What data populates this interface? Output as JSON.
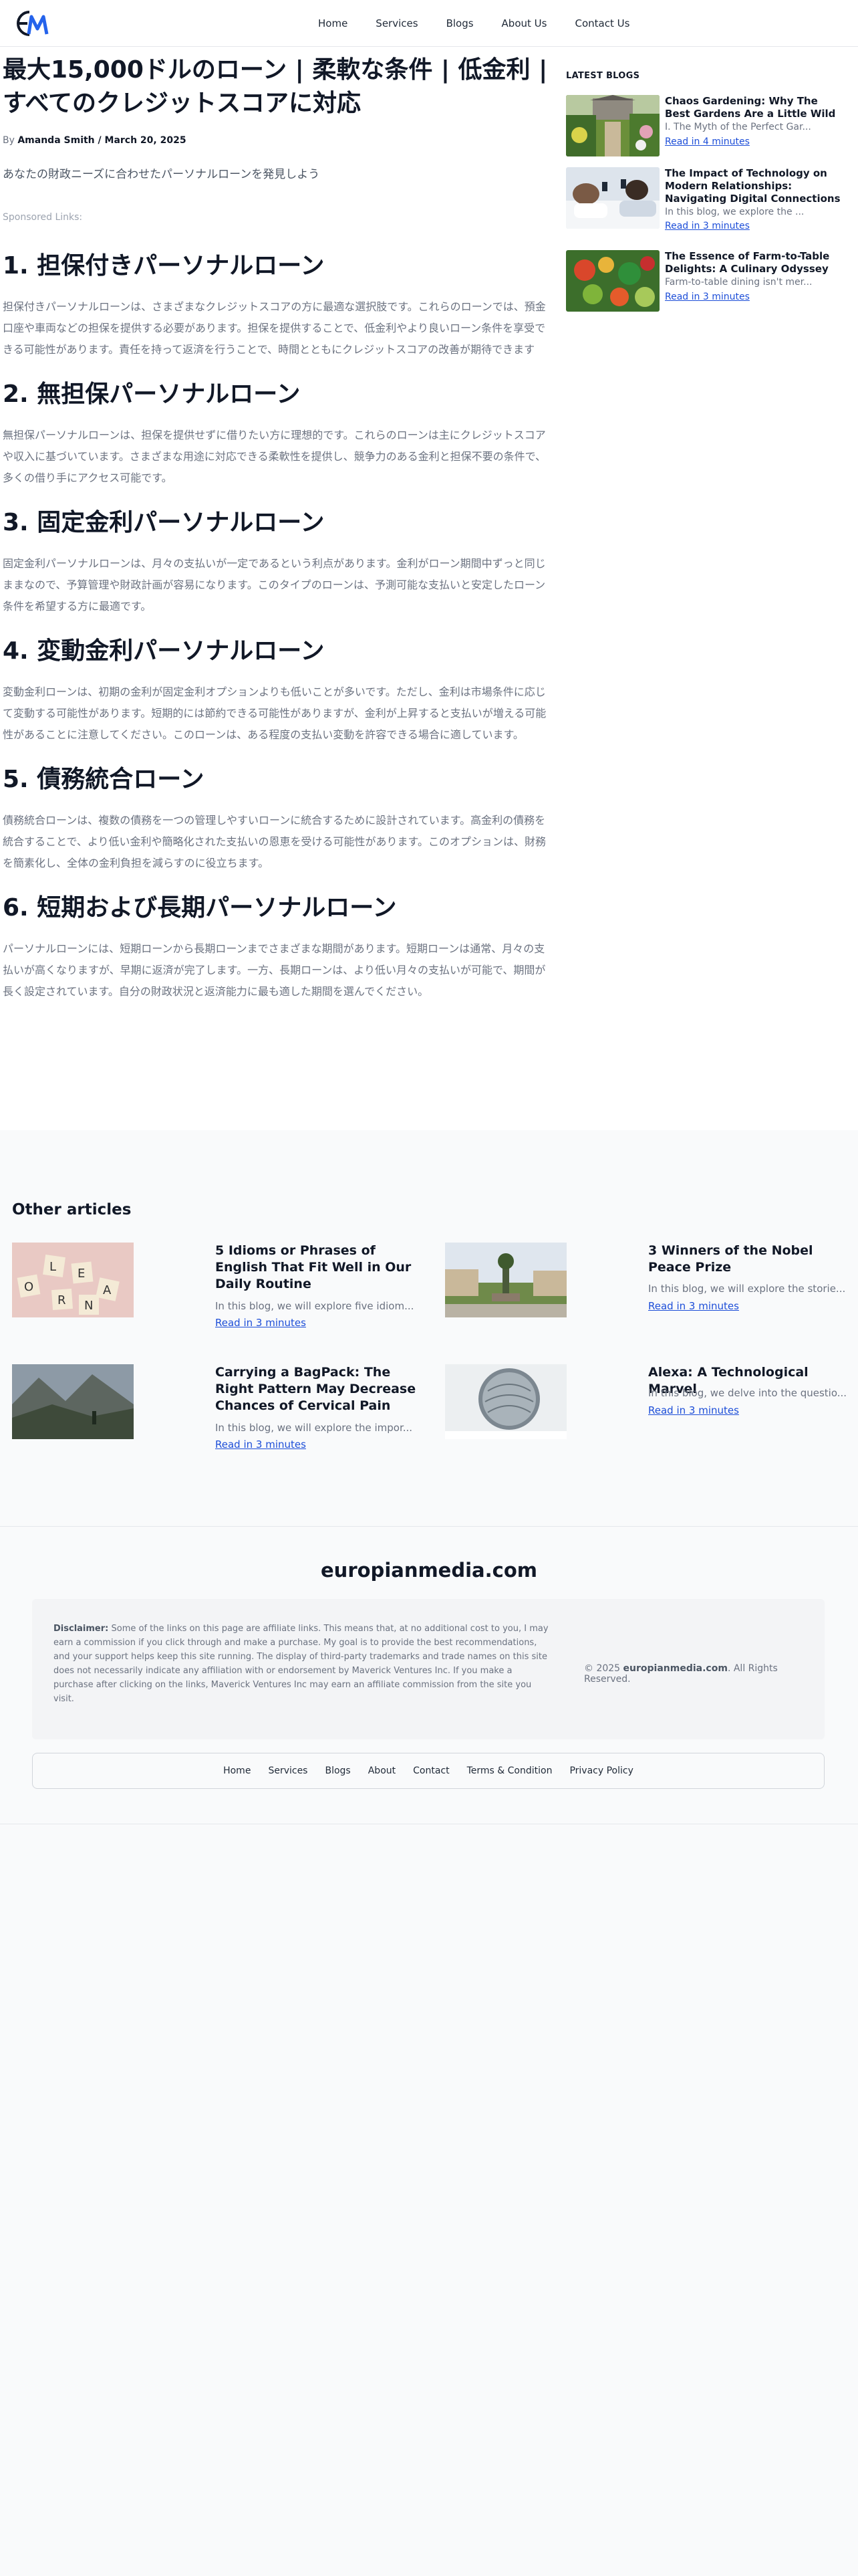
{
  "header": {
    "logo_text": "EM",
    "nav": [
      "Home",
      "Services",
      "Blogs",
      "About Us",
      "Contact Us"
    ]
  },
  "article": {
    "title": "最大15,000ドルのローン | 柔軟な条件 | 低金利 | すべてのクレジットスコアに対応",
    "by_prefix": "By",
    "author": "Amanda Smith / March 20, 2025",
    "intro": "あなたの財政ニーズに合わせたパーソナルローンを発見しよう",
    "sponsored": "Sponsored Links:",
    "sections": [
      {
        "heading": "1. 担保付きパーソナルローン",
        "body": "担保付きパーソナルローンは、さまざまなクレジットスコアの方に最適な選択肢です。これらのローンでは、預金口座や車両などの担保を提供する必要があります。担保を提供することで、低金利やより良いローン条件を享受できる可能性があります。責任を持って返済を行うことで、時間とともにクレジットスコアの改善が期待できます"
      },
      {
        "heading": "2. 無担保パーソナルローン",
        "body": "無担保パーソナルローンは、担保を提供せずに借りたい方に理想的です。これらのローンは主にクレジットスコアや収入に基づいています。さまざまな用途に対応できる柔軟性を提供し、競争力のある金利と担保不要の条件で、多くの借り手にアクセス可能です。"
      },
      {
        "heading": "3. 固定金利パーソナルローン",
        "body": "固定金利パーソナルローンは、月々の支払いが一定であるという利点があります。金利がローン期間中ずっと同じままなので、予算管理や財政計画が容易になります。このタイプのローンは、予測可能な支払いと安定したローン条件を希望する方に最適です。"
      },
      {
        "heading": "4. 変動金利パーソナルローン",
        "body": "変動金利ローンは、初期の金利が固定金利オプションよりも低いことが多いです。ただし、金利は市場条件に応じて変動する可能性があります。短期的には節約できる可能性がありますが、金利が上昇すると支払いが増える可能性があることに注意してください。このローンは、ある程度の支払い変動を許容できる場合に適しています。"
      },
      {
        "heading": "5. 債務統合ローン",
        "body": "債務統合ローンは、複数の債務を一つの管理しやすいローンに統合するために設計されています。高金利の債務を統合することで、より低い金利や簡略化された支払いの恩恵を受ける可能性があります。このオプションは、財務を簡素化し、全体の金利負担を減らすのに役立ちます。"
      },
      {
        "heading": "6. 短期および長期パーソナルローン",
        "body": "パーソナルローンには、短期ローンから長期ローンまでさまざまな期間があります。短期ローンは通常、月々の支払いが高くなりますが、早期に返済が完了します。一方、長期ローンは、より低い月々の支払いが可能で、期間が長く設定されています。自分の財政状況と返済能力に最も適した期間を選んでください。"
      }
    ]
  },
  "sidebar": {
    "title": "LATEST BLOGS",
    "items": [
      {
        "title": "Chaos Gardening: Why The Best Gardens Are a Little Wild",
        "desc": "I. The Myth of the Perfect Gar...",
        "link": "Read in 4 minutes"
      },
      {
        "title": "The Impact of Technology on Modern Relationships: Navigating Digital Connections",
        "desc": "In this blog, we explore the ...",
        "link": "Read in 3 minutes"
      },
      {
        "title": "The Essence of Farm-to-Table Delights: A Culinary Odyssey",
        "desc": "Farm-to-table dining isn't mer...",
        "link": "Read in 3 minutes"
      }
    ]
  },
  "other": {
    "title": "Other articles",
    "cards": [
      {
        "title": "5 Idioms or Phrases of English That Fit Well in Our Daily Routine",
        "desc": "In this blog, we will explore five idiom...",
        "link": "Read in 3 minutes"
      },
      {
        "title": "3 Winners of the Nobel Peace Prize",
        "desc": "In this blog, we will explore the storie...",
        "link": "Read in 3 minutes"
      },
      {
        "title": "Carrying a BagPack: The Right Pattern May Decrease Chances of Cervical Pain",
        "desc": "In this blog, we will explore the impor...",
        "link": "Read in 3 minutes"
      },
      {
        "title": "Alexa: A Technological Marvel",
        "desc": "In this blog, we delve into the questio...",
        "link": "Read in 3 minutes"
      }
    ]
  },
  "footer": {
    "brand": "europianmedia.com",
    "disclaimer_label": "Disclaimer:",
    "disclaimer": "Some of the links on this page are affiliate links. This means that, at no additional cost to you, I may earn a commission if you click through and make a purchase. My goal is to provide the best recommendations, and your support helps keep this site running. The display of third-party trademarks and trade names on this site does not necessarily indicate any affiliation with or endorsement by Maverick Ventures Inc. If you make a purchase after clicking on the links, Maverick Ventures Inc may earn an affiliate commission from the site you visit.",
    "copyright_prefix": "© 2025",
    "copyright_site": "europianmedia.com",
    "copyright_suffix": ". All Rights Reserved.",
    "nav": [
      "Home",
      "Services",
      "Blogs",
      "About",
      "Contact",
      "Terms & Condition",
      "Privacy Policy"
    ]
  },
  "colors": {
    "link": "#1d4ed8",
    "logo_dark": "#111827",
    "logo_blue": "#2563eb"
  }
}
